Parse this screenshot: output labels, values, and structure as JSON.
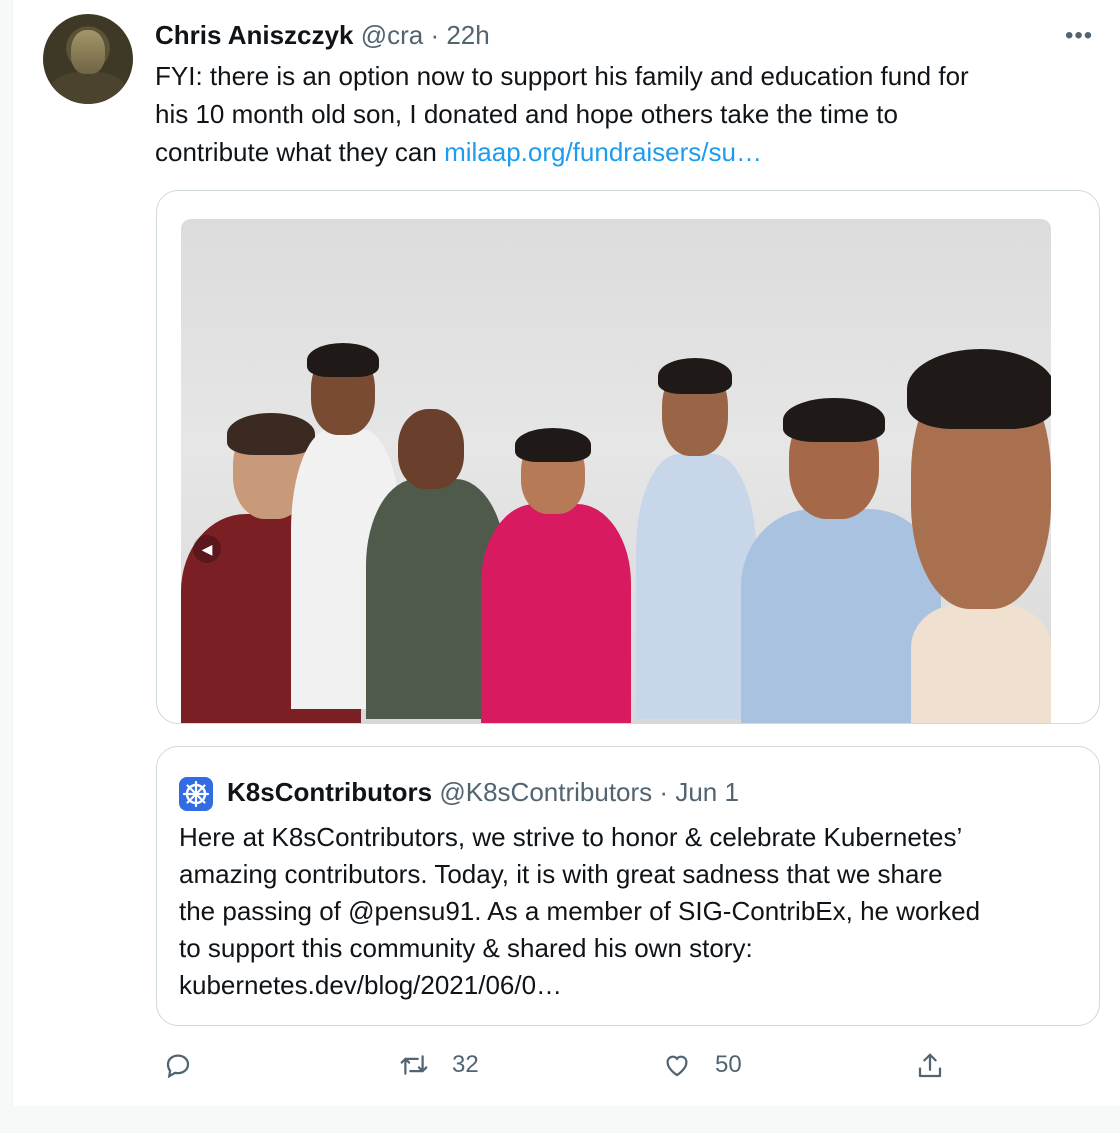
{
  "tweet": {
    "author_name": "Chris Aniszczyk",
    "author_handle": "@cra",
    "separator": "·",
    "time": "22h",
    "more": "•••",
    "text_line1": "FYI: there is an option now to support his family and education fund for",
    "text_line2": "his 10 month old son, I donated and hope others take the time to",
    "text_line3_prefix": "contribute what they can ",
    "link": "milaap.org/fundraisers/su…"
  },
  "quoted": {
    "name": "K8sContributors",
    "handle": "@K8sContributors",
    "separator": "·",
    "date": "Jun 1",
    "line1": "Here at K8sContributors, we strive to honor & celebrate Kubernetes’",
    "line2": "amazing contributors. Today, it is with great sadness that we share",
    "line3": "the passing of @pensu91. As a member of SIG-ContribEx, he worked",
    "line4": "to support this community & shared his own story:",
    "line5": "kubernetes.dev/blog/2021/06/0…"
  },
  "actions": {
    "reply_icon": "reply-icon",
    "retweet_count": "32",
    "like_count": "50",
    "share_icon": "share-icon"
  },
  "colors": {
    "link": "#1d9bf0",
    "secondary": "#536471",
    "k8s_blue": "#326ce5"
  }
}
